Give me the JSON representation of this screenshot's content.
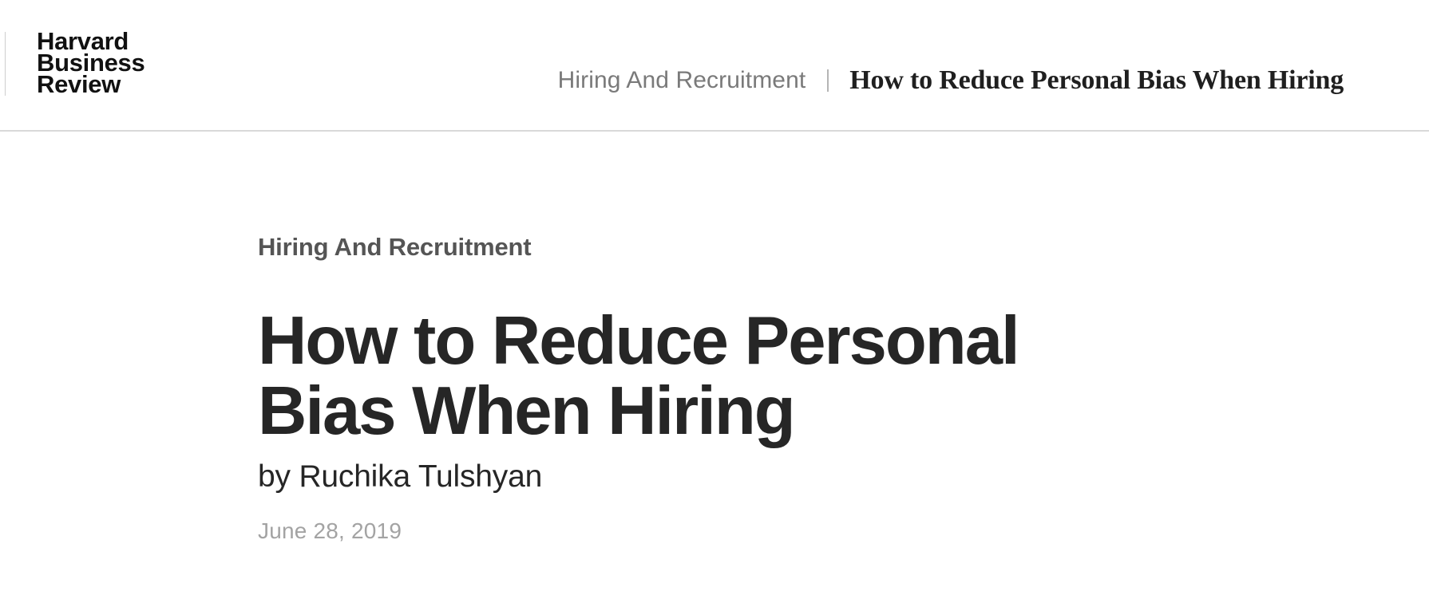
{
  "header": {
    "logo_lines": [
      "Harvard",
      "Business",
      "Review"
    ],
    "breadcrumb_topic": "Hiring And Recruitment",
    "breadcrumb_title": "How to Reduce Personal Bias When Hiring"
  },
  "article": {
    "topic": "Hiring And Recruitment",
    "title": "How to Reduce Personal Bias When Hiring",
    "byline_prefix": "by",
    "author": "Ruchika Tulshyan",
    "date": "June 28, 2019"
  },
  "colors": {
    "text_primary": "#262626",
    "text_muted": "#7a7a7a",
    "date_gray": "#a3a3a3",
    "divider": "#d9d9d9"
  }
}
